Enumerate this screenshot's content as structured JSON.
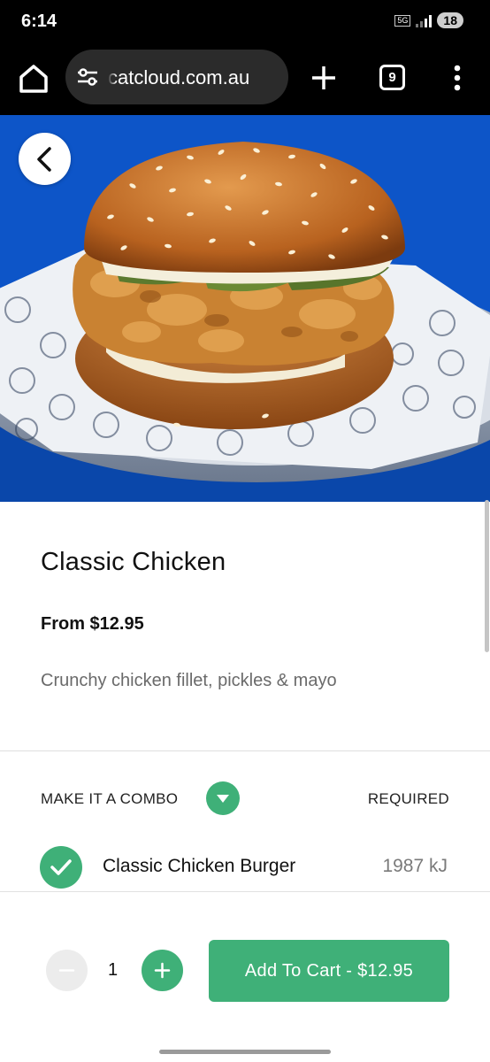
{
  "status_bar": {
    "time": "6:14",
    "network": "5G",
    "battery": "18"
  },
  "browser": {
    "url": "catcloud.com.au",
    "tab_count": "9",
    "icons": [
      "home-icon",
      "site-settings-icon",
      "new-tab-plus-icon",
      "tab-switcher-icon",
      "overflow-menu-icon"
    ]
  },
  "product": {
    "image_alt": "Classic Chicken burger",
    "title": "Classic Chicken",
    "price": "From $12.95",
    "description": "Crunchy chicken fillet, pickles & mayo"
  },
  "combo": {
    "heading": "MAKE IT A COMBO",
    "required_label": "REQUIRED",
    "options": [
      {
        "name": "Classic Chicken Burger",
        "energy": "1987 kJ",
        "selected": true
      }
    ]
  },
  "cart": {
    "quantity": "1",
    "add_label": "Add To Cart - $12.95"
  },
  "colors": {
    "accent": "#3fb078",
    "hero_background": "#0d55c8",
    "browser_bar": "#000000"
  }
}
